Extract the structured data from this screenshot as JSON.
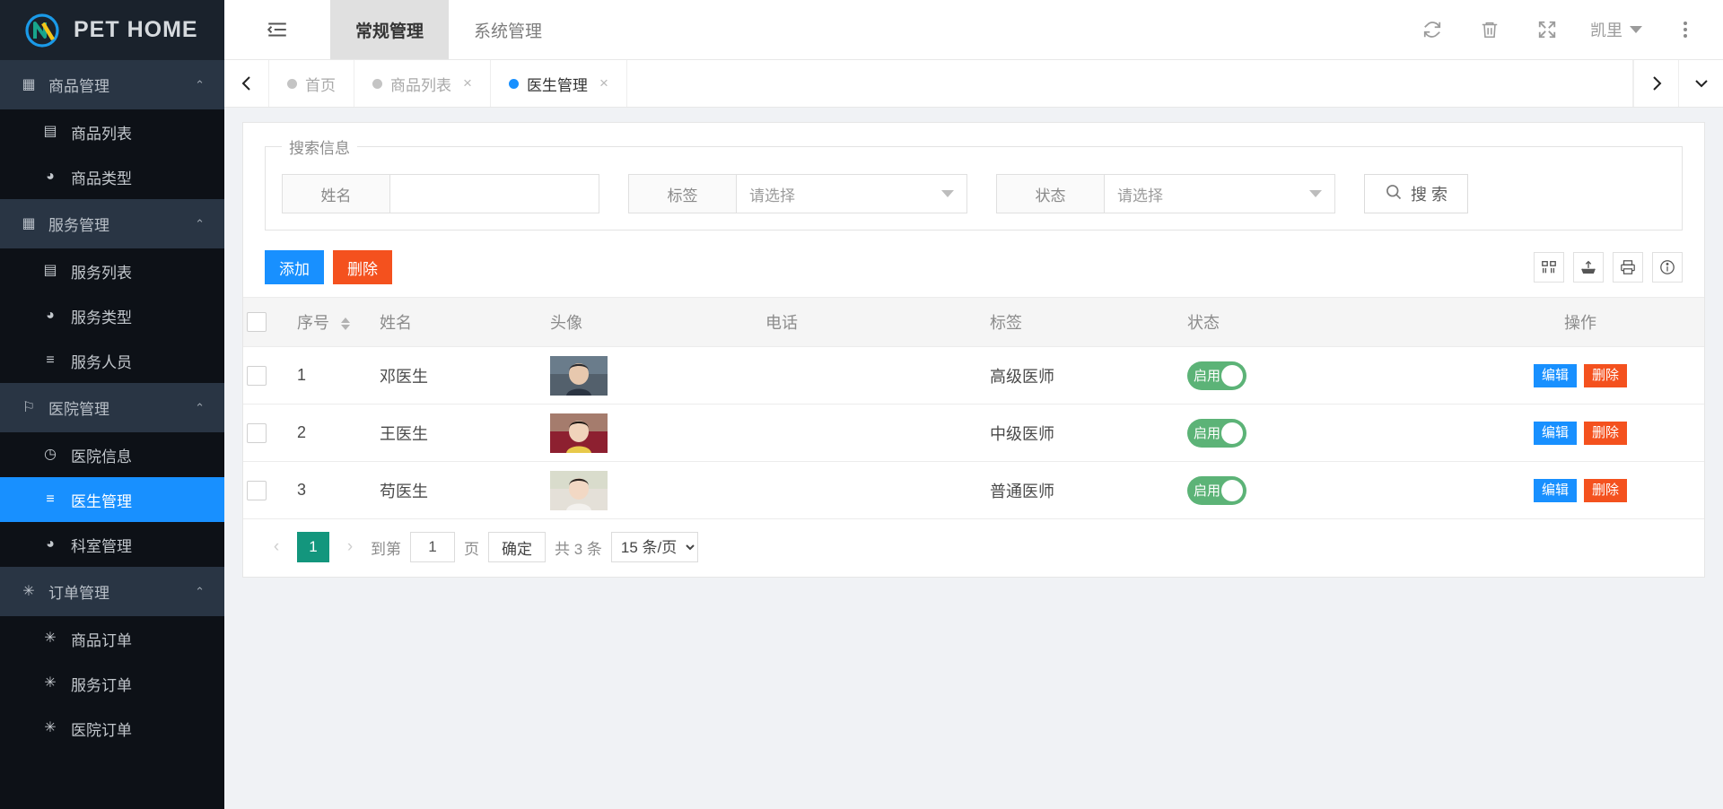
{
  "brand": {
    "name": "PET HOME"
  },
  "sidebar": {
    "groups": [
      {
        "label": "商品管理",
        "icon": "calendar-icon",
        "items": [
          {
            "label": "商品列表",
            "icon": "list-icon",
            "active": false
          },
          {
            "label": "商品类型",
            "icon": "dashboard-icon",
            "active": false
          }
        ]
      },
      {
        "label": "服务管理",
        "icon": "calendar-icon",
        "items": [
          {
            "label": "服务列表",
            "icon": "list-icon",
            "active": false
          },
          {
            "label": "服务类型",
            "icon": "dashboard-icon",
            "active": false
          },
          {
            "label": "服务人员",
            "icon": "menu-icon",
            "active": false
          }
        ]
      },
      {
        "label": "医院管理",
        "icon": "flag-icon",
        "items": [
          {
            "label": "医院信息",
            "icon": "clock-icon",
            "active": false
          },
          {
            "label": "医生管理",
            "icon": "menu-icon",
            "active": true
          },
          {
            "label": "科室管理",
            "icon": "dashboard-icon",
            "active": false
          }
        ]
      },
      {
        "label": "订单管理",
        "icon": "asterisk-icon",
        "items": [
          {
            "label": "商品订单",
            "icon": "asterisk-icon",
            "active": false
          },
          {
            "label": "服务订单",
            "icon": "asterisk-icon",
            "active": false
          },
          {
            "label": "医院订单",
            "icon": "asterisk-icon",
            "active": false
          }
        ]
      }
    ]
  },
  "topbar": {
    "collapse_icon": "menu-fold-icon",
    "nav": [
      {
        "label": "常规管理",
        "active": true
      },
      {
        "label": "系统管理",
        "active": false
      }
    ],
    "icons": [
      "refresh-icon",
      "trash-icon",
      "fullscreen-icon"
    ],
    "user": "凯里",
    "more_icon": "more-vertical-icon"
  },
  "tabbar": {
    "prev": "‹",
    "next": "›",
    "dropdown": "⌄",
    "tabs": [
      {
        "label": "首页",
        "active": false,
        "closable": false
      },
      {
        "label": "商品列表",
        "active": false,
        "closable": true
      },
      {
        "label": "医生管理",
        "active": true,
        "closable": true
      }
    ]
  },
  "search": {
    "legend": "搜索信息",
    "name_label": "姓名",
    "name_value": "",
    "name_placeholder": "",
    "tag_label": "标签",
    "tag_value": "请选择",
    "status_label": "状态",
    "status_value": "请选择",
    "search_button": "搜 索",
    "search_icon": "search-icon"
  },
  "toolbar": {
    "add_label": "添加",
    "delete_label": "删除",
    "tools": [
      "columns-icon",
      "export-icon",
      "print-icon",
      "info-icon"
    ]
  },
  "table": {
    "columns": [
      "",
      "序号",
      "姓名",
      "头像",
      "电话",
      "标签",
      "状态",
      "操作"
    ],
    "rows": [
      {
        "index": "1",
        "name": "邓医生",
        "avatar": "doctor-photo-1",
        "phone": "",
        "tag": "高级医师",
        "status": "启用",
        "edit": "编辑",
        "remove": "删除"
      },
      {
        "index": "2",
        "name": "王医生",
        "avatar": "doctor-photo-2",
        "phone": "",
        "tag": "中级医师",
        "status": "启用",
        "edit": "编辑",
        "remove": "删除"
      },
      {
        "index": "3",
        "name": "苟医生",
        "avatar": "doctor-photo-3",
        "phone": "",
        "tag": "普通医师",
        "status": "启用",
        "edit": "编辑",
        "remove": "删除"
      }
    ]
  },
  "pagination": {
    "prev": "‹",
    "next": "›",
    "current_page": "1",
    "goto_prefix": "到第",
    "goto_value": "1",
    "goto_suffix": "页",
    "confirm": "确定",
    "total": "共 3 条",
    "page_size": "15 条/页"
  },
  "colors": {
    "accent_blue": "#1890ff",
    "danger_orange": "#f4511e",
    "toggle_green": "#5cb377",
    "pager_teal": "#13967d",
    "sidebar_bg": "#0d1117",
    "sidebar_group_bg": "#293544"
  }
}
